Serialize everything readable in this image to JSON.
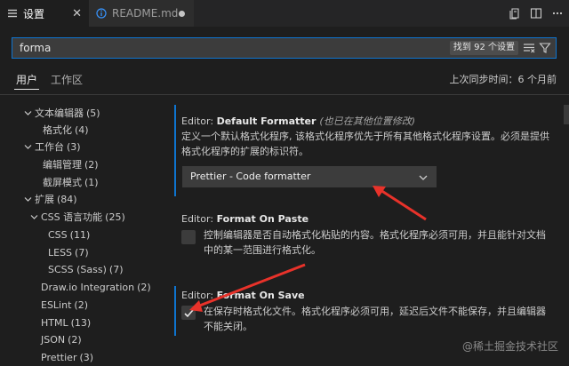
{
  "tabs": [
    {
      "label": "设置",
      "active": true,
      "icon": "settings-list-icon"
    },
    {
      "label": "README.md",
      "active": false,
      "icon": "info-icon",
      "dirty": true
    }
  ],
  "search": {
    "value": "forma",
    "placeholder": "",
    "result_badge": "找到 92 个设置"
  },
  "scope": {
    "user_label": "用户",
    "workspace_label": "工作区",
    "sync_text": "上次同步时间：6 个月前"
  },
  "toc": [
    {
      "label": "文本编辑器",
      "count": "(5)",
      "expanded": true
    },
    {
      "label": "格式化",
      "count": "(4)"
    },
    {
      "label": "工作台",
      "count": "(3)",
      "expanded": true
    },
    {
      "label": "编辑管理",
      "count": "(2)"
    },
    {
      "label": "截屏模式",
      "count": "(1)"
    },
    {
      "label": "扩展",
      "count": "(84)",
      "expanded": true
    },
    {
      "label": "CSS 语言功能",
      "count": "(25)",
      "expanded": true
    },
    {
      "label": "CSS",
      "count": "(11)"
    },
    {
      "label": "LESS",
      "count": "(7)"
    },
    {
      "label": "SCSS (Sass)",
      "count": "(7)"
    },
    {
      "label": "Draw.io Integration",
      "count": "(2)"
    },
    {
      "label": "ESLint",
      "count": "(2)"
    },
    {
      "label": "HTML",
      "count": "(13)"
    },
    {
      "label": "JSON",
      "count": "(2)"
    },
    {
      "label": "Prettier",
      "count": "(3)"
    }
  ],
  "settings": {
    "default_formatter": {
      "category": "Editor: ",
      "name": "Default Formatter",
      "modified_note": "(也已在其他位置修改)",
      "description": "定义一个默认格式化程序, 该格式化程序优先于所有其他格式化程序设置。必须是提供格式化程序的扩展的标识符。",
      "value": "Prettier - Code formatter"
    },
    "format_on_paste": {
      "category": "Editor: ",
      "name": "Format On Paste",
      "description": "控制编辑器是否自动格式化粘贴的内容。格式化程序必须可用，并且能针对文档中的某一范围进行格式化。",
      "checked": false
    },
    "format_on_save": {
      "category": "Editor: ",
      "name": "Format On Save",
      "description": "在保存时格式化文件。格式化程序必须可用，延迟后文件不能保存，并且编辑器不能关闭。",
      "checked": true
    }
  },
  "watermark": "@稀土掘金技术社区",
  "colors": {
    "accent": "#0e74cf",
    "annotation_arrow": "#e8322a",
    "background": "#1e1e1e"
  }
}
